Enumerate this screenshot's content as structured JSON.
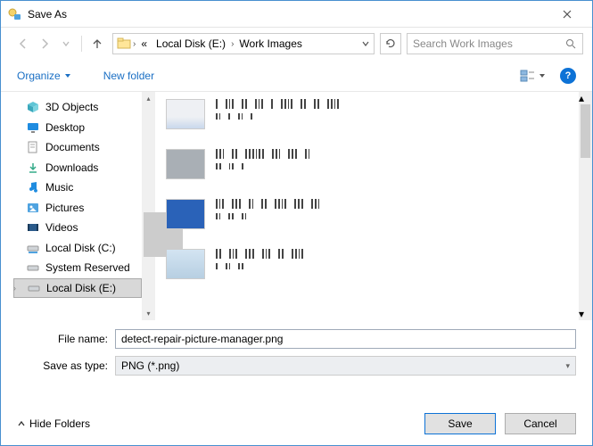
{
  "window": {
    "title": "Save As"
  },
  "breadcrumb": {
    "overflow": "«",
    "seg1": "Local Disk (E:)",
    "seg2": "Work Images"
  },
  "search": {
    "placeholder": "Search Work Images"
  },
  "toolbar": {
    "organize": "Organize",
    "newfolder": "New folder"
  },
  "tree": {
    "items": [
      {
        "label": "3D Objects"
      },
      {
        "label": "Desktop"
      },
      {
        "label": "Documents"
      },
      {
        "label": "Downloads"
      },
      {
        "label": "Music"
      },
      {
        "label": "Pictures"
      },
      {
        "label": "Videos"
      },
      {
        "label": "Local Disk (C:)"
      },
      {
        "label": "System Reserved"
      },
      {
        "label": "Local Disk (E:)"
      }
    ]
  },
  "form": {
    "filename_label": "File name:",
    "filename_value": "detect-repair-picture-manager.png",
    "type_label": "Save as type:",
    "type_value": "PNG (*.png)"
  },
  "footer": {
    "hidefolders": "Hide Folders",
    "save": "Save",
    "cancel": "Cancel"
  }
}
